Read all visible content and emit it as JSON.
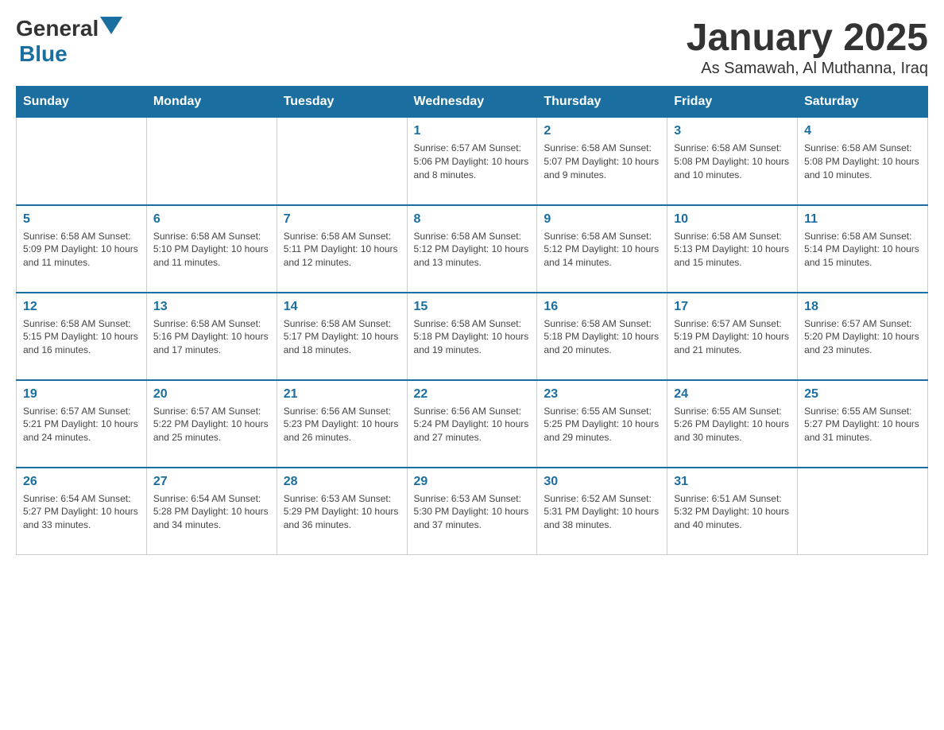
{
  "logo": {
    "text1": "General",
    "text2": "Blue"
  },
  "title": "January 2025",
  "subtitle": "As Samawah, Al Muthanna, Iraq",
  "days_of_week": [
    "Sunday",
    "Monday",
    "Tuesday",
    "Wednesday",
    "Thursday",
    "Friday",
    "Saturday"
  ],
  "weeks": [
    [
      {
        "day": "",
        "info": ""
      },
      {
        "day": "",
        "info": ""
      },
      {
        "day": "",
        "info": ""
      },
      {
        "day": "1",
        "info": "Sunrise: 6:57 AM\nSunset: 5:06 PM\nDaylight: 10 hours and 8 minutes."
      },
      {
        "day": "2",
        "info": "Sunrise: 6:58 AM\nSunset: 5:07 PM\nDaylight: 10 hours and 9 minutes."
      },
      {
        "day": "3",
        "info": "Sunrise: 6:58 AM\nSunset: 5:08 PM\nDaylight: 10 hours and 10 minutes."
      },
      {
        "day": "4",
        "info": "Sunrise: 6:58 AM\nSunset: 5:08 PM\nDaylight: 10 hours and 10 minutes."
      }
    ],
    [
      {
        "day": "5",
        "info": "Sunrise: 6:58 AM\nSunset: 5:09 PM\nDaylight: 10 hours and 11 minutes."
      },
      {
        "day": "6",
        "info": "Sunrise: 6:58 AM\nSunset: 5:10 PM\nDaylight: 10 hours and 11 minutes."
      },
      {
        "day": "7",
        "info": "Sunrise: 6:58 AM\nSunset: 5:11 PM\nDaylight: 10 hours and 12 minutes."
      },
      {
        "day": "8",
        "info": "Sunrise: 6:58 AM\nSunset: 5:12 PM\nDaylight: 10 hours and 13 minutes."
      },
      {
        "day": "9",
        "info": "Sunrise: 6:58 AM\nSunset: 5:12 PM\nDaylight: 10 hours and 14 minutes."
      },
      {
        "day": "10",
        "info": "Sunrise: 6:58 AM\nSunset: 5:13 PM\nDaylight: 10 hours and 15 minutes."
      },
      {
        "day": "11",
        "info": "Sunrise: 6:58 AM\nSunset: 5:14 PM\nDaylight: 10 hours and 15 minutes."
      }
    ],
    [
      {
        "day": "12",
        "info": "Sunrise: 6:58 AM\nSunset: 5:15 PM\nDaylight: 10 hours and 16 minutes."
      },
      {
        "day": "13",
        "info": "Sunrise: 6:58 AM\nSunset: 5:16 PM\nDaylight: 10 hours and 17 minutes."
      },
      {
        "day": "14",
        "info": "Sunrise: 6:58 AM\nSunset: 5:17 PM\nDaylight: 10 hours and 18 minutes."
      },
      {
        "day": "15",
        "info": "Sunrise: 6:58 AM\nSunset: 5:18 PM\nDaylight: 10 hours and 19 minutes."
      },
      {
        "day": "16",
        "info": "Sunrise: 6:58 AM\nSunset: 5:18 PM\nDaylight: 10 hours and 20 minutes."
      },
      {
        "day": "17",
        "info": "Sunrise: 6:57 AM\nSunset: 5:19 PM\nDaylight: 10 hours and 21 minutes."
      },
      {
        "day": "18",
        "info": "Sunrise: 6:57 AM\nSunset: 5:20 PM\nDaylight: 10 hours and 23 minutes."
      }
    ],
    [
      {
        "day": "19",
        "info": "Sunrise: 6:57 AM\nSunset: 5:21 PM\nDaylight: 10 hours and 24 minutes."
      },
      {
        "day": "20",
        "info": "Sunrise: 6:57 AM\nSunset: 5:22 PM\nDaylight: 10 hours and 25 minutes."
      },
      {
        "day": "21",
        "info": "Sunrise: 6:56 AM\nSunset: 5:23 PM\nDaylight: 10 hours and 26 minutes."
      },
      {
        "day": "22",
        "info": "Sunrise: 6:56 AM\nSunset: 5:24 PM\nDaylight: 10 hours and 27 minutes."
      },
      {
        "day": "23",
        "info": "Sunrise: 6:55 AM\nSunset: 5:25 PM\nDaylight: 10 hours and 29 minutes."
      },
      {
        "day": "24",
        "info": "Sunrise: 6:55 AM\nSunset: 5:26 PM\nDaylight: 10 hours and 30 minutes."
      },
      {
        "day": "25",
        "info": "Sunrise: 6:55 AM\nSunset: 5:27 PM\nDaylight: 10 hours and 31 minutes."
      }
    ],
    [
      {
        "day": "26",
        "info": "Sunrise: 6:54 AM\nSunset: 5:27 PM\nDaylight: 10 hours and 33 minutes."
      },
      {
        "day": "27",
        "info": "Sunrise: 6:54 AM\nSunset: 5:28 PM\nDaylight: 10 hours and 34 minutes."
      },
      {
        "day": "28",
        "info": "Sunrise: 6:53 AM\nSunset: 5:29 PM\nDaylight: 10 hours and 36 minutes."
      },
      {
        "day": "29",
        "info": "Sunrise: 6:53 AM\nSunset: 5:30 PM\nDaylight: 10 hours and 37 minutes."
      },
      {
        "day": "30",
        "info": "Sunrise: 6:52 AM\nSunset: 5:31 PM\nDaylight: 10 hours and 38 minutes."
      },
      {
        "day": "31",
        "info": "Sunrise: 6:51 AM\nSunset: 5:32 PM\nDaylight: 10 hours and 40 minutes."
      },
      {
        "day": "",
        "info": ""
      }
    ]
  ]
}
